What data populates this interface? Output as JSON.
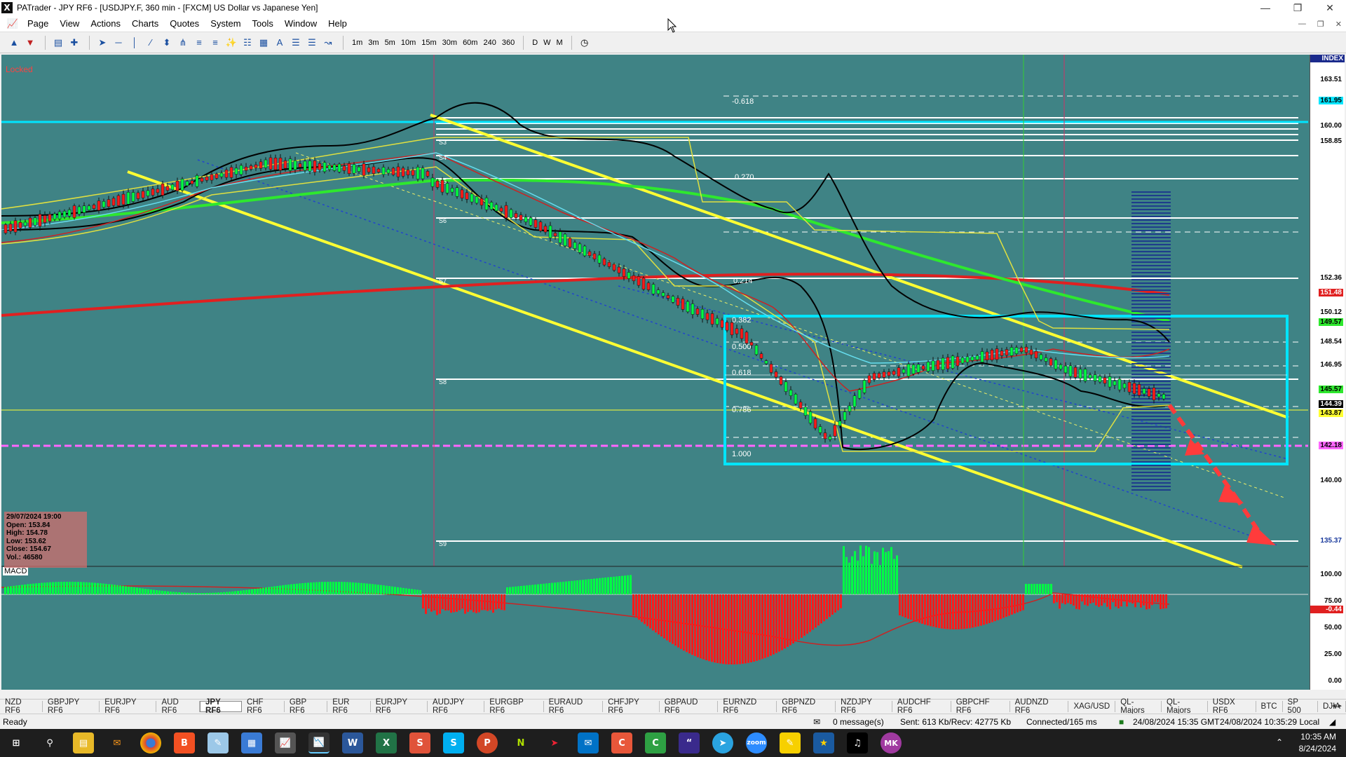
{
  "window": {
    "title": "PATrader - JPY RF6 - [USDJPY.F, 360 min - [FXCM] US Dollar vs Japanese Yen]",
    "app_icon_letter": "X"
  },
  "menu": [
    "Page",
    "View",
    "Actions",
    "Charts",
    "Quotes",
    "System",
    "Tools",
    "Window",
    "Help"
  ],
  "timeframes": [
    "1m",
    "3m",
    "5m",
    "10m",
    "15m",
    "30m",
    "60m",
    "240",
    "360",
    "D",
    "W",
    "M"
  ],
  "chart": {
    "locked_label": "Locked",
    "index_label": "INDEX",
    "macd_label": "MACD",
    "fib_labels": [
      "-0.618",
      "0.270",
      "0.214",
      "0.382",
      "0.500",
      "0.618",
      "0.786",
      "1.000"
    ],
    "level_labels": [
      "S3",
      "S4",
      "S5",
      "S6",
      "S7",
      "S8",
      "S9"
    ],
    "ohlc": {
      "date": "29/07/2024 19:00",
      "open": "Open: 153.84",
      "high": "High: 154.78",
      "low": "Low: 153.62",
      "close": "Close: 154.67",
      "vol": "Vol.: 46580"
    },
    "price_ticks": [
      "163.51",
      "160.00",
      "158.85",
      "152.36",
      "151.48",
      "150.12",
      "148.54",
      "146.95",
      "145.57",
      "144.39",
      "143.87",
      "142.18",
      "140.00",
      "135.37"
    ],
    "highlighted_prices": {
      "p161": "161.95",
      "p151": "151.48",
      "p149": "149.57",
      "p145": "145.57",
      "p144": "144.39",
      "p143": "143.87",
      "p142": "142.18"
    },
    "macd_ticks": [
      "100.00",
      "75.00",
      "50.00",
      "25.00",
      "0.00"
    ],
    "macd_value": "-0.44",
    "colors": {
      "background": "#3f8385",
      "bull": "#00ff44",
      "bear": "#ff1a1a",
      "channel": "#ffff33",
      "box": "#00e5ff",
      "ma_red": "#e02020",
      "ma_green": "#2ee82e"
    }
  },
  "tabs": [
    "NZD RF6",
    "GBPJPY RF6",
    "EURJPY RF6",
    "AUD RF6",
    "JPY RF6",
    "CHF RF6",
    "GBP RF6",
    "EUR RF6",
    "EURJPY RF6",
    "AUDJPY RF6",
    "EURGBP RF6",
    "EURAUD RF6",
    "CHFJPY RF6",
    "GBPAUD RF6",
    "EURNZD RF6",
    "GBPNZD RF6",
    "NZDJPY RF6",
    "AUDCHF RF6",
    "GBPCHF RF6",
    "AUDNZD RF6",
    "XAG/USD",
    "QL-Majors",
    "QL-Majors",
    "USDX RF6",
    "BTC",
    "SP 500",
    "DJIA"
  ],
  "active_tab": "JPY RF6",
  "status": {
    "ready": "Ready",
    "messages": "0 message(s)",
    "traffic": "Sent: 613 Kb/Recv: 42775 Kb",
    "connection": "Connected/165 ms",
    "gmt": "24/08/2024 15:35 GMT",
    "local": "24/08/2024 10:35:29 Local"
  },
  "clock": {
    "time": "10:35 AM",
    "date": "8/24/2024"
  }
}
